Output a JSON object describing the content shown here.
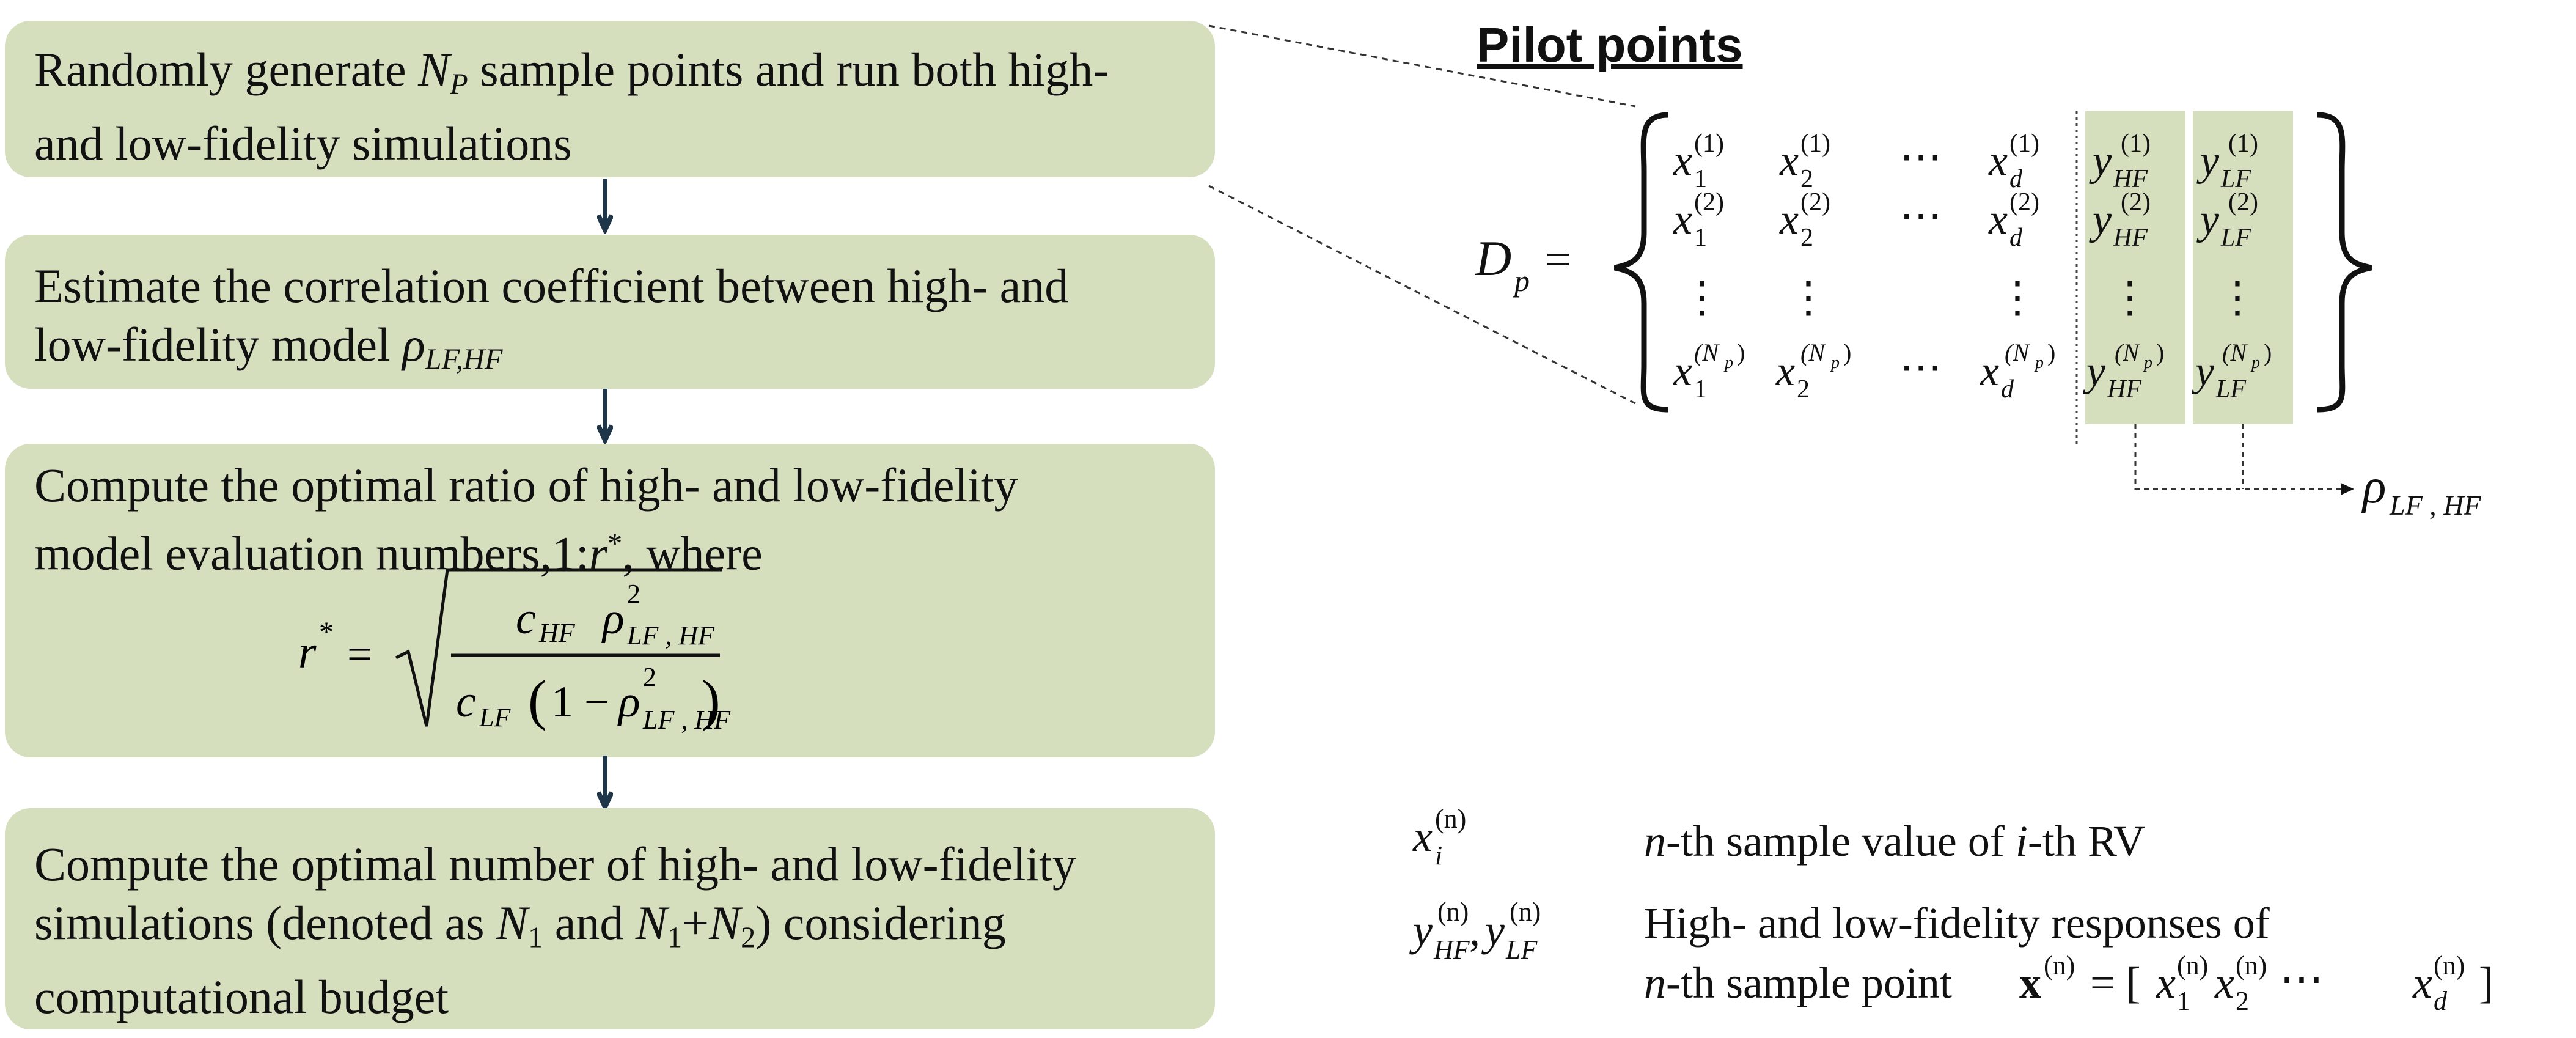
{
  "steps": [
    {
      "line1_a": "Randomly generate ",
      "sym_N": "N",
      "sym_P": "P",
      "line1_b": " sample points and run both high-",
      "line2": "and low-fidelity simulations"
    },
    {
      "line1": "Estimate the correlation coefficient between high- and",
      "line2_a": "low-fidelity model ",
      "rho": "ρ",
      "rho_sub": "LF,HF"
    },
    {
      "line1": "Compute the optimal ratio of high- and low-fidelity",
      "line2_a": "model evaluation numbers,1:",
      "r": "r",
      "star": "*",
      "line2_b": ", where"
    },
    {
      "line1": "Compute the optimal number of high- and low-fidelity",
      "line2_a": "simulations (denoted as ",
      "N": "N",
      "one": "1",
      "and": " and ",
      "plus": "+",
      "two": "2",
      "line2_b": ") considering",
      "line3": "computational budget"
    }
  ],
  "formula": {
    "lhs_r": "r",
    "lhs_star": "*",
    "eq": "=",
    "c": "c",
    "hf": "HF",
    "lf": "LF",
    "rho": "ρ",
    "two": "2",
    "lfhf": "LF , HF",
    "one_minus": "1 −",
    "lp": "(",
    "rp": ")"
  },
  "pilot": {
    "title": "Pilot points",
    "D": "D",
    "p": "p",
    "eq": "=",
    "x": "x",
    "y": "y",
    "idx": [
      "1",
      "2",
      "d"
    ],
    "sup_rows": [
      "(1)",
      "(2)",
      "(N",
      "p",
      ")"
    ],
    "dots_h": "⋯",
    "dots_v": "⋮",
    "hf": "HF",
    "lf": "LF",
    "rho": "ρ",
    "rho_sub": "LF , HF"
  },
  "legend": {
    "x": "x",
    "i": "i",
    "n_sup": "(n)",
    "desc1_n": "n",
    "desc1_a": "-th sample value of ",
    "desc1_i": "i",
    "desc1_b": "-th RV",
    "y": "y",
    "hf": "HF",
    "lf": "LF",
    "comma": ",",
    "desc2_line1": "High- and low-fidelity responses of",
    "desc2_n": "n",
    "desc2_a": "-th sample point  ",
    "bold_x": "x",
    "eq": "= [ ",
    "dots": "⋯",
    "d": "d",
    "close": " ]",
    "one": "1",
    "two": "2"
  },
  "colors": {
    "box_fill": "#d5dfbe",
    "arrow": "#1f3548",
    "highlight": "#d5dfbe"
  }
}
